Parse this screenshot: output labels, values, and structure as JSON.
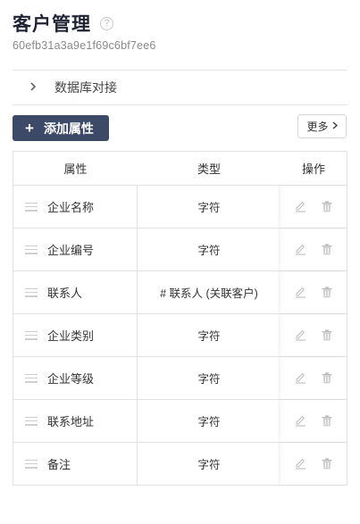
{
  "header": {
    "title": "客户管理",
    "help_icon": "?",
    "subtitle": "60efb31a3a9e1f69c6bf7ee6"
  },
  "collapse": {
    "chevron": "›",
    "label": "数据库对接"
  },
  "toolbar": {
    "add_label": "添加属性",
    "add_icon": "+",
    "more_label": "更多",
    "more_chevron": "›"
  },
  "table": {
    "headers": [
      "属性",
      "类型",
      "操作"
    ],
    "rows": [
      {
        "name": "企业名称",
        "type": "字符"
      },
      {
        "name": "企业编号",
        "type": "字符"
      },
      {
        "name": "联系人",
        "type": "# 联系人 (关联客户)"
      },
      {
        "name": "企业类别",
        "type": "字符"
      },
      {
        "name": "企业等级",
        "type": "字符"
      },
      {
        "name": "联系地址",
        "type": "字符"
      },
      {
        "name": "备注",
        "type": "字符"
      }
    ]
  },
  "colors": {
    "primary_button": "#3c4a68",
    "icon_gray": "#c4c4c4",
    "border": "#e2e2e2"
  }
}
